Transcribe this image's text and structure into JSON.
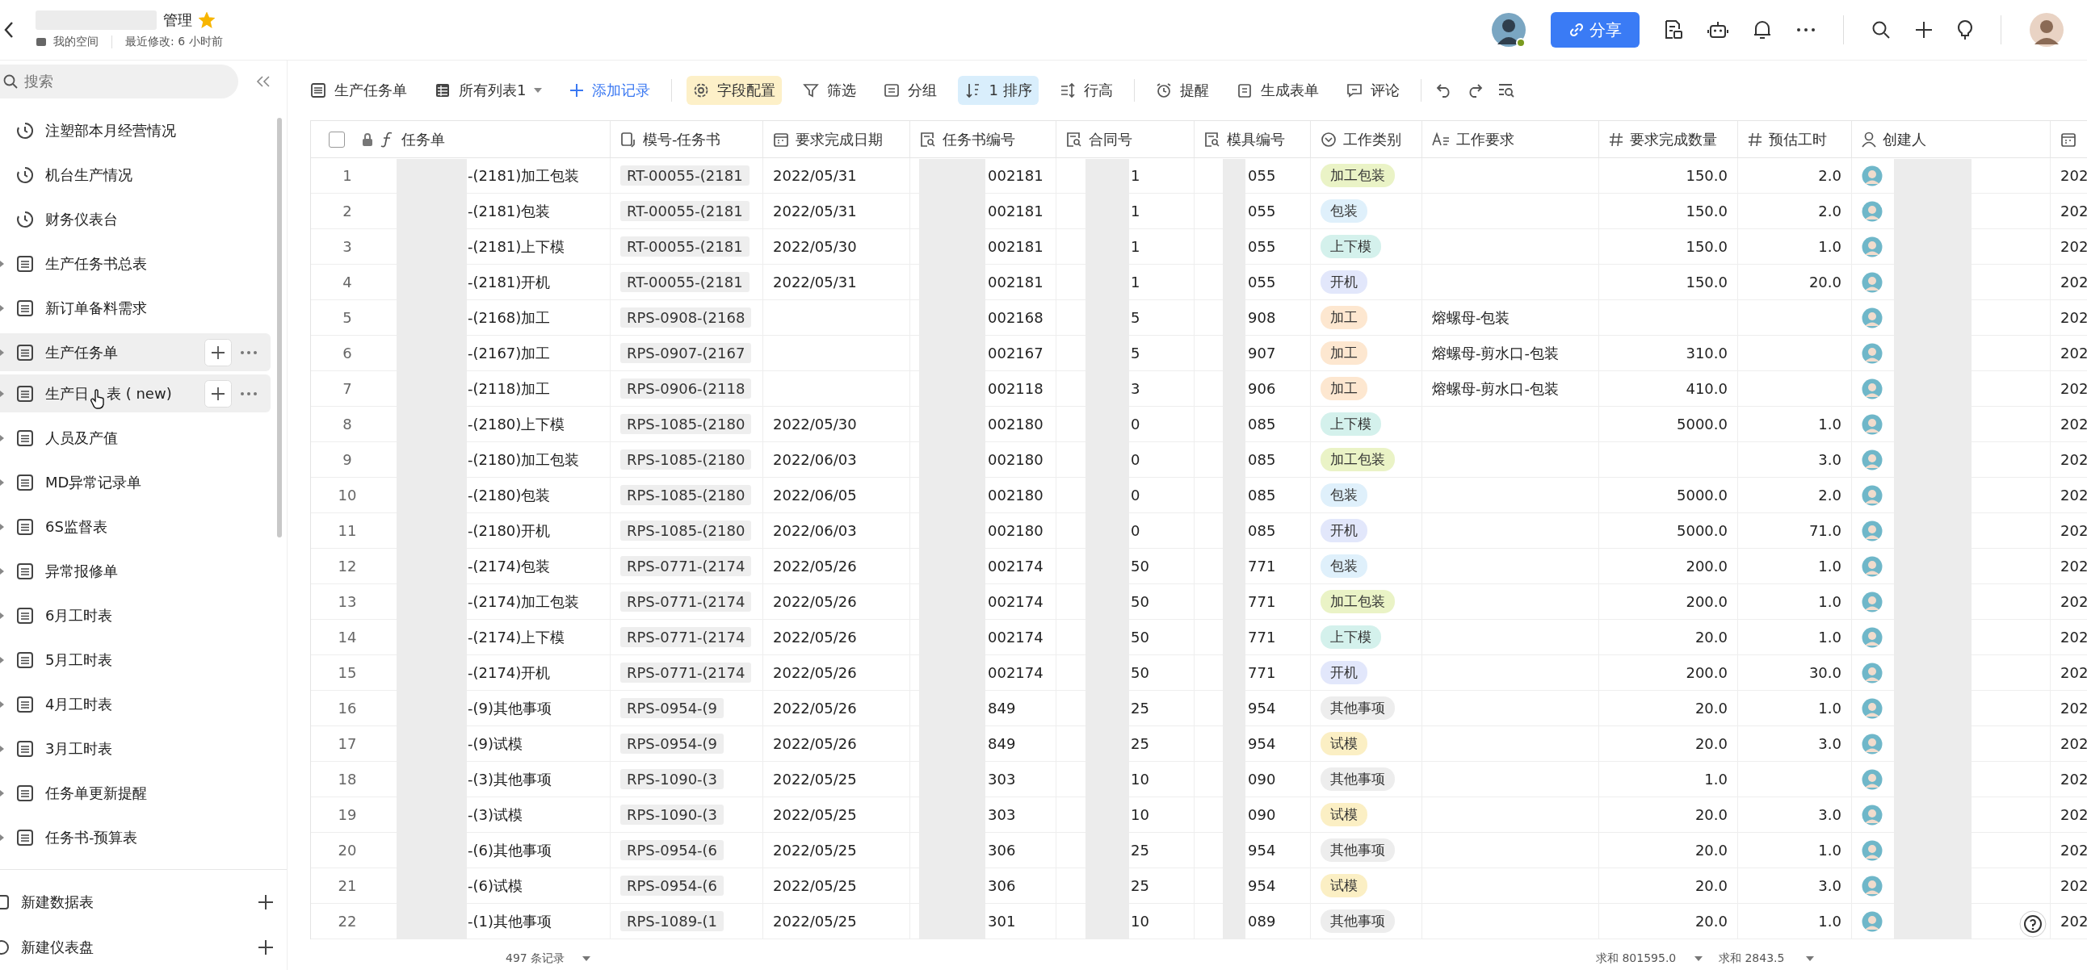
{
  "header": {
    "title": "管理",
    "starred": true,
    "space": "我的空间",
    "modified": "最近修改: 6 小时前",
    "share_button": "分享"
  },
  "sidebar": {
    "search": {
      "placeholder": "搜索"
    },
    "items": [
      {
        "label": "注塑部本月经营情况",
        "kind": "dashboard",
        "highlighted": false
      },
      {
        "label": "机台生产情况",
        "kind": "dashboard",
        "highlighted": false
      },
      {
        "label": "财务仪表台",
        "kind": "dashboard",
        "highlighted": false
      },
      {
        "label": "生产任务书总表",
        "kind": "table",
        "highlighted": false
      },
      {
        "label": "新订单备料需求",
        "kind": "table",
        "highlighted": false
      },
      {
        "label": "生产任务单",
        "kind": "table",
        "highlighted": true
      },
      {
        "label": "生产日",
        "label_continued": "表 ( new)",
        "kind": "table",
        "highlighted": true
      },
      {
        "label": "人员及产值",
        "kind": "table",
        "highlighted": false
      },
      {
        "label": "MD异常记录单",
        "kind": "table",
        "highlighted": false
      },
      {
        "label": "6S监督表",
        "kind": "table",
        "highlighted": false
      },
      {
        "label": "异常报修单",
        "kind": "table",
        "highlighted": false
      },
      {
        "label": "6月工时表",
        "kind": "table",
        "highlighted": false
      },
      {
        "label": "5月工时表",
        "kind": "table",
        "highlighted": false
      },
      {
        "label": "4月工时表",
        "kind": "table",
        "highlighted": false
      },
      {
        "label": "3月工时表",
        "kind": "table",
        "highlighted": false
      },
      {
        "label": "任务单更新提醒",
        "kind": "table",
        "highlighted": false
      },
      {
        "label": "任务书-预算表",
        "kind": "table",
        "highlighted": false
      }
    ],
    "new_items": [
      {
        "label": "新建数据表",
        "kind": "table"
      },
      {
        "label": "新建仪表盘",
        "kind": "dashboard"
      }
    ]
  },
  "toolbar": [
    {
      "label": "生产任务单",
      "kind": "table"
    },
    {
      "label": "所有列表1",
      "kind": "view"
    },
    {
      "label": "添加记录",
      "kind": "add"
    },
    {
      "label": "字段配置",
      "kind": "fields",
      "color": "#fdf0c8"
    },
    {
      "label": "筛选",
      "kind": "filter"
    },
    {
      "label": "分组",
      "kind": "group"
    },
    {
      "label": "1 排序",
      "kind": "sort",
      "color": "#d9eefc"
    },
    {
      "label": "行高",
      "kind": "height"
    },
    {
      "label": "提醒",
      "kind": "alarm"
    },
    {
      "label": "生成表单",
      "kind": "form"
    },
    {
      "label": "评论",
      "kind": "comment"
    }
  ],
  "table": {
    "select_all": {
      "checked": false
    },
    "columns": [
      {
        "label": "任务单",
        "kind": "formula"
      },
      {
        "label": "模号-任务书",
        "kind": "link"
      },
      {
        "label": "要求完成日期",
        "kind": "date"
      },
      {
        "label": "任务书编号",
        "kind": "lookup"
      },
      {
        "label": "合同号",
        "kind": "lookup"
      },
      {
        "label": "模具编号",
        "kind": "lookup"
      },
      {
        "label": "工作类别",
        "kind": "select"
      },
      {
        "label": "工作要求",
        "kind": "text"
      },
      {
        "label": "要求完成数量",
        "kind": "number"
      },
      {
        "label": "预估工时",
        "kind": "number"
      },
      {
        "label": "创建人",
        "kind": "user"
      },
      {
        "kind": "date"
      }
    ],
    "rows": [
      {
        "num": "1",
        "task": "-(2181)加工包装",
        "mold_task": "RT-00055-(2181",
        "due": "2022/05/31",
        "book_no": "002181",
        "contract": "1",
        "mold_no": "055",
        "work_type": {
          "label": "加工包装",
          "color": "#eaf3c6"
        },
        "qty": "150.0",
        "hours": "2.0",
        "column_12": "202"
      },
      {
        "num": "2",
        "task": "-(2181)包装",
        "mold_task": "RT-00055-(2181",
        "due": "2022/05/31",
        "book_no": "002181",
        "contract": "1",
        "mold_no": "055",
        "work_type": {
          "label": "包装",
          "color": "#dff0fb"
        },
        "qty": "150.0",
        "hours": "2.0",
        "column_12": "202"
      },
      {
        "num": "3",
        "task": "-(2181)上下模",
        "mold_task": "RT-00055-(2181",
        "due": "2022/05/30",
        "book_no": "002181",
        "contract": "1",
        "mold_no": "055",
        "work_type": {
          "label": "上下模",
          "color": "#d4f1ec"
        },
        "qty": "150.0",
        "hours": "1.0",
        "column_12": "202"
      },
      {
        "num": "4",
        "task": "-(2181)开机",
        "mold_task": "RT-00055-(2181",
        "due": "2022/05/31",
        "book_no": "002181",
        "contract": "1",
        "mold_no": "055",
        "work_type": {
          "label": "开机",
          "color": "#e2e7fb"
        },
        "qty": "150.0",
        "hours": "20.0",
        "column_12": "202"
      },
      {
        "num": "5",
        "task": "-(2168)加工",
        "mold_task": "RPS-0908-(2168",
        "book_no": "002168",
        "contract": "5",
        "mold_no": "908",
        "work_type": {
          "label": "加工",
          "color": "#fde7d0"
        },
        "work_req": "熔螺母-包装",
        "column_12": "202"
      },
      {
        "num": "6",
        "task": "-(2167)加工",
        "mold_task": "RPS-0907-(2167",
        "book_no": "002167",
        "contract": "5",
        "mold_no": "907",
        "work_type": {
          "label": "加工",
          "color": "#fde7d0"
        },
        "work_req": "熔螺母-剪水口-包装",
        "qty": "310.0",
        "column_12": "202"
      },
      {
        "num": "7",
        "task": "-(2118)加工",
        "mold_task": "RPS-0906-(2118",
        "book_no": "002118",
        "contract": "3",
        "mold_no": "906",
        "work_type": {
          "label": "加工",
          "color": "#fde7d0"
        },
        "work_req": "熔螺母-剪水口-包装",
        "qty": "410.0",
        "column_12": "202"
      },
      {
        "num": "8",
        "task": "-(2180)上下模",
        "mold_task": "RPS-1085-(2180",
        "due": "2022/05/30",
        "book_no": "002180",
        "contract": "0",
        "mold_no": "085",
        "work_type": {
          "label": "上下模",
          "color": "#d4f1ec"
        },
        "qty": "5000.0",
        "hours": "1.0",
        "column_12": "202"
      },
      {
        "num": "9",
        "task": "-(2180)加工包装",
        "mold_task": "RPS-1085-(2180",
        "due": "2022/06/03",
        "book_no": "002180",
        "contract": "0",
        "mold_no": "085",
        "work_type": {
          "label": "加工包装",
          "color": "#eaf3c6"
        },
        "hours": "3.0",
        "column_12": "202"
      },
      {
        "num": "10",
        "task": "-(2180)包装",
        "mold_task": "RPS-1085-(2180",
        "due": "2022/06/05",
        "book_no": "002180",
        "contract": "0",
        "mold_no": "085",
        "work_type": {
          "label": "包装",
          "color": "#dff0fb"
        },
        "qty": "5000.0",
        "hours": "2.0",
        "column_12": "202"
      },
      {
        "num": "11",
        "task": "-(2180)开机",
        "mold_task": "RPS-1085-(2180",
        "due": "2022/06/03",
        "book_no": "002180",
        "contract": "0",
        "mold_no": "085",
        "work_type": {
          "label": "开机",
          "color": "#e2e7fb"
        },
        "qty": "5000.0",
        "hours": "71.0",
        "column_12": "202"
      },
      {
        "num": "12",
        "task": "-(2174)包装",
        "mold_task": "RPS-0771-(2174",
        "due": "2022/05/26",
        "book_no": "002174",
        "contract": "50",
        "mold_no": "771",
        "work_type": {
          "label": "包装",
          "color": "#dff0fb"
        },
        "qty": "200.0",
        "hours": "1.0",
        "column_12": "202"
      },
      {
        "num": "13",
        "task": "-(2174)加工包装",
        "mold_task": "RPS-0771-(2174",
        "due": "2022/05/26",
        "book_no": "002174",
        "contract": "50",
        "mold_no": "771",
        "work_type": {
          "label": "加工包装",
          "color": "#eaf3c6"
        },
        "qty": "200.0",
        "hours": "1.0",
        "column_12": "202"
      },
      {
        "num": "14",
        "task": "-(2174)上下模",
        "mold_task": "RPS-0771-(2174",
        "due": "2022/05/26",
        "book_no": "002174",
        "contract": "50",
        "mold_no": "771",
        "work_type": {
          "label": "上下模",
          "color": "#d4f1ec"
        },
        "qty": "20.0",
        "hours": "1.0",
        "column_12": "202"
      },
      {
        "num": "15",
        "task": "-(2174)开机",
        "mold_task": "RPS-0771-(2174",
        "due": "2022/05/26",
        "book_no": "002174",
        "contract": "50",
        "mold_no": "771",
        "work_type": {
          "label": "开机",
          "color": "#e2e7fb"
        },
        "qty": "200.0",
        "hours": "30.0",
        "column_12": "202"
      },
      {
        "num": "16",
        "task": "-(9)其他事项",
        "mold_task": "RPS-0954-(9",
        "due": "2022/05/26",
        "book_no": "849",
        "contract": "25",
        "mold_no": "954",
        "work_type": {
          "label": "其他事项",
          "color": "#ededed"
        },
        "qty": "20.0",
        "hours": "1.0",
        "column_12": "202"
      },
      {
        "num": "17",
        "task": "-(9)试模",
        "mold_task": "RPS-0954-(9",
        "due": "2022/05/26",
        "book_no": "849",
        "contract": "25",
        "mold_no": "954",
        "work_type": {
          "label": "试模",
          "color": "#fbefc4"
        },
        "qty": "20.0",
        "hours": "3.0",
        "column_12": "202"
      },
      {
        "num": "18",
        "task": "-(3)其他事项",
        "mold_task": "RPS-1090-(3",
        "due": "2022/05/25",
        "book_no": "303",
        "contract": "10",
        "mold_no": "090",
        "work_type": {
          "label": "其他事项",
          "color": "#ededed"
        },
        "qty": "1.0",
        "column_12": "202"
      },
      {
        "num": "19",
        "task": "-(3)试模",
        "mold_task": "RPS-1090-(3",
        "due": "2022/05/25",
        "book_no": "303",
        "contract": "10",
        "mold_no": "090",
        "work_type": {
          "label": "试模",
          "color": "#fbefc4"
        },
        "qty": "20.0",
        "hours": "3.0",
        "column_12": "202"
      },
      {
        "num": "20",
        "task": "-(6)其他事项",
        "mold_task": "RPS-0954-(6",
        "due": "2022/05/25",
        "book_no": "306",
        "contract": "25",
        "mold_no": "954",
        "work_type": {
          "label": "其他事项",
          "color": "#ededed"
        },
        "qty": "20.0",
        "hours": "1.0",
        "column_12": "202"
      },
      {
        "num": "21",
        "task": "-(6)试模",
        "mold_task": "RPS-0954-(6",
        "due": "2022/05/25",
        "book_no": "306",
        "contract": "25",
        "mold_no": "954",
        "work_type": {
          "label": "试模",
          "color": "#fbefc4"
        },
        "qty": "20.0",
        "hours": "3.0",
        "column_12": "202"
      },
      {
        "num": "22",
        "task": "-(1)其他事项",
        "mold_task": "RPS-1089-(1",
        "due": "2022/05/25",
        "book_no": "301",
        "contract": "10",
        "mold_no": "089",
        "work_type": {
          "label": "其他事项",
          "color": "#ededed"
        },
        "qty": "20.0",
        "hours": "1.0",
        "column_12": "202"
      }
    ]
  },
  "footer": {
    "record_count": "497 条记录",
    "qty_sum": "求和 801595.0",
    "hours_sum": "求和 2843.5"
  }
}
